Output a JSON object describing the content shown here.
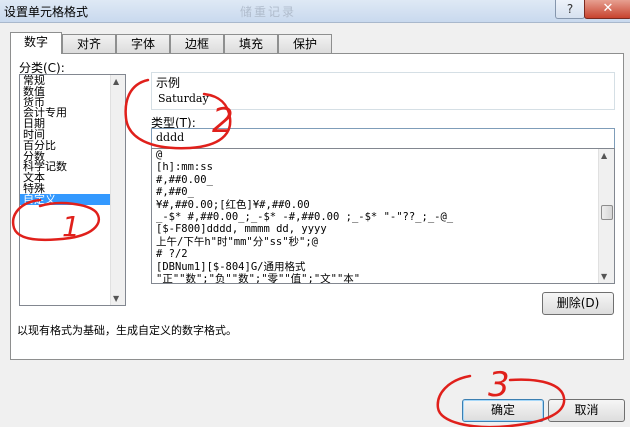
{
  "window": {
    "title": "设置单元格格式",
    "ghost_title": "储重记录",
    "help": "?",
    "close": "✕"
  },
  "tabs": [
    "数字",
    "对齐",
    "字体",
    "边框",
    "填充",
    "保护"
  ],
  "category": {
    "label": "分类(C):",
    "items": [
      "常规",
      "数值",
      "货币",
      "会计专用",
      "日期",
      "时间",
      "百分比",
      "分数",
      "科学记数",
      "文本",
      "特殊",
      "自定义"
    ],
    "selected": "自定义"
  },
  "sample": {
    "label": "示例",
    "value": "Saturday"
  },
  "type": {
    "label": "类型(T):",
    "value": "dddd",
    "list": [
      "@",
      "[h]:mm:ss",
      "#,##0.00_",
      "#,##0_",
      "¥#,##0.00;[红色]¥#,##0.00",
      "_-$* #,##0.00_;_-$* -#,##0.00 ;_-$* \"-\"??_;_-@_",
      "[$-F800]dddd, mmmm dd, yyyy",
      "上午/下午h\"时\"mm\"分\"ss\"秒\";@",
      "# ?/2",
      "[DBNum1][$-804]G/通用格式",
      "\"正\"\"数\";\"负\"\"数\";\"零\"\"值\";\"文\"\"本\""
    ]
  },
  "buttons": {
    "delete": "删除(D)",
    "ok": "确定",
    "cancel": "取消"
  },
  "description": "以现有格式为基础，生成自定义的数字格式。",
  "annotations": [
    "1",
    "2",
    "3"
  ],
  "colors": {
    "annotation": "#e0201b",
    "selection": "#3399ff"
  }
}
